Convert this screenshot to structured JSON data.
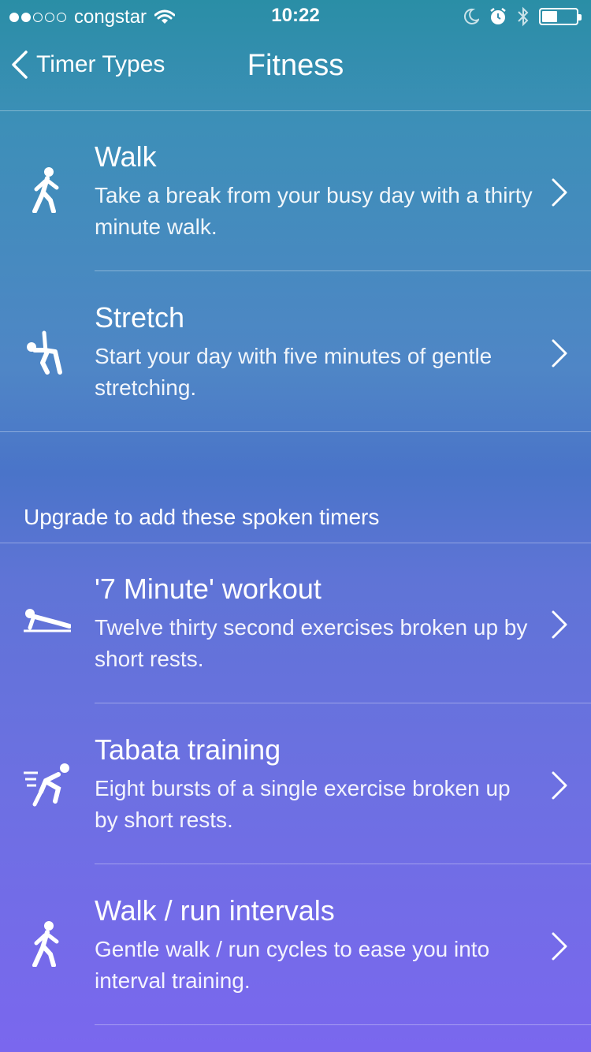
{
  "status_bar": {
    "carrier": "congstar",
    "time": "10:22"
  },
  "nav": {
    "back_label": "Timer Types",
    "title": "Fitness"
  },
  "timers": [
    {
      "title": "Walk",
      "description": "Take a break from your busy day with a thirty minute walk.",
      "icon": "walk-icon"
    },
    {
      "title": "Stretch",
      "description": "Start your day with five minutes of gentle stretching.",
      "icon": "stretch-icon"
    }
  ],
  "upgrade_section": {
    "header": "Upgrade to add these spoken timers",
    "items": [
      {
        "title": "'7 Minute' workout",
        "description": "Twelve thirty second exercises broken up by short rests.",
        "icon": "pushup-icon"
      },
      {
        "title": "Tabata training",
        "description": "Eight bursts of a single exercise broken up by short rests.",
        "icon": "sprint-icon"
      },
      {
        "title": "Walk / run intervals",
        "description": "Gentle walk / run cycles to ease you into interval training.",
        "icon": "walk-icon"
      }
    ]
  },
  "colors": {
    "gradient_top": "#2a8ea6",
    "gradient_bottom": "#7a67ee"
  }
}
